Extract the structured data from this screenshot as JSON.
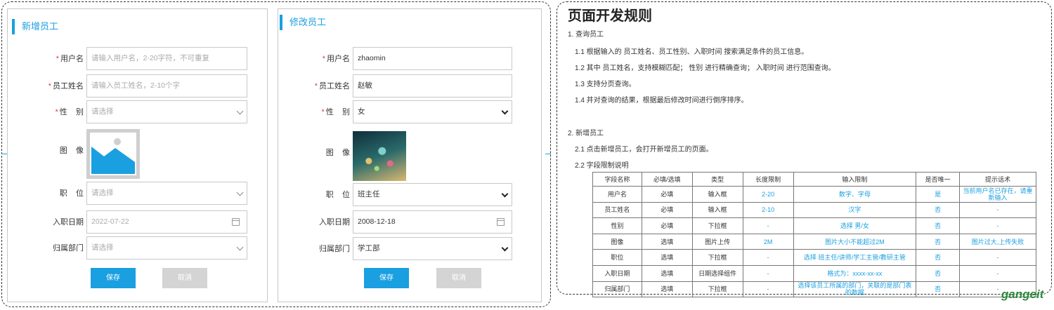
{
  "add_form": {
    "title": "新增员工",
    "fields": [
      {
        "label": "用户名",
        "required": true,
        "value": "请输入用户名，2-20字符，不可重复",
        "placeholder": true
      },
      {
        "label": "员工姓名",
        "required": true,
        "value": "请输入员工姓名，2-10个字",
        "placeholder": true
      },
      {
        "label": "性    别",
        "required": true,
        "value": "请选择",
        "placeholder": true
      }
    ],
    "image_label": "图    像",
    "position_label": "职    位",
    "position_value": "请选择",
    "date_label": "入职日期",
    "date_value": "2022-07-22",
    "dept_label": "归属部门",
    "dept_value": "请选择",
    "save": "保存",
    "cancel": "取消"
  },
  "edit_form": {
    "title": "修改员工",
    "fields": [
      {
        "label": "用户名",
        "required": true,
        "value": "zhaomin"
      },
      {
        "label": "员工姓名",
        "required": true,
        "value": "赵敏"
      },
      {
        "label": "性    别",
        "required": true,
        "value": "女"
      }
    ],
    "image_label": "图    像",
    "position_label": "职    位",
    "position_value": "班主任",
    "date_label": "入职日期",
    "date_value": "2008-12-18",
    "dept_label": "归属部门",
    "dept_value": "学工部",
    "save": "保存",
    "cancel": "取消"
  },
  "rules": {
    "title": "页面开发规则",
    "s1": "1. 查询员工",
    "s1_1": "1.1 根据输入的 员工姓名、员工性别、入职时间 搜索满足条件的员工信息。",
    "s1_2": "1.2 其中 员工姓名，支持模糊匹配； 性别 进行精确查询； 入职时间 进行范围查询。",
    "s1_3": "1.3 支持分页查询。",
    "s1_4": "1.4 并对查询的结果，根据最后修改时间进行倒序排序。",
    "s2": "2. 新增员工",
    "s2_1": "2.1 点击新增员工，会打开新增员工的页面。",
    "s2_2": "2.2 字段限制说明",
    "table": {
      "headers": [
        "字段名称",
        "必填/选填",
        "类型",
        "长度限制",
        "输入限制",
        "是否唯一",
        "提示话术"
      ],
      "rows": [
        [
          "用户名",
          "必填",
          "输入框",
          "2-20",
          "数字、字母",
          "是",
          "当前用户名已存在，请重新输入"
        ],
        [
          "员工姓名",
          "必填",
          "输入框",
          "2-10",
          "汉字",
          "否",
          "-"
        ],
        [
          "性别",
          "必填",
          "下拉框",
          "-",
          "选择 男/女",
          "否",
          "-"
        ],
        [
          "图像",
          "选填",
          "图片上传",
          "2M",
          "图片大小不能超过2M",
          "否",
          "图片过大,上传失败"
        ],
        [
          "职位",
          "选填",
          "下拉框",
          "-",
          "选择 班主任/讲师/学工主管/教研主管",
          "否",
          "-"
        ],
        [
          "入职日期",
          "选填",
          "日期选择组件",
          "-",
          "格式为：xxxx-xx-xx",
          "否",
          "-"
        ],
        [
          "归属部门",
          "选填",
          "下拉框",
          "-",
          "选择该员工所属的部门，关联的是部门表的数据",
          "否",
          "-"
        ]
      ]
    }
  },
  "logo": "gangeit"
}
